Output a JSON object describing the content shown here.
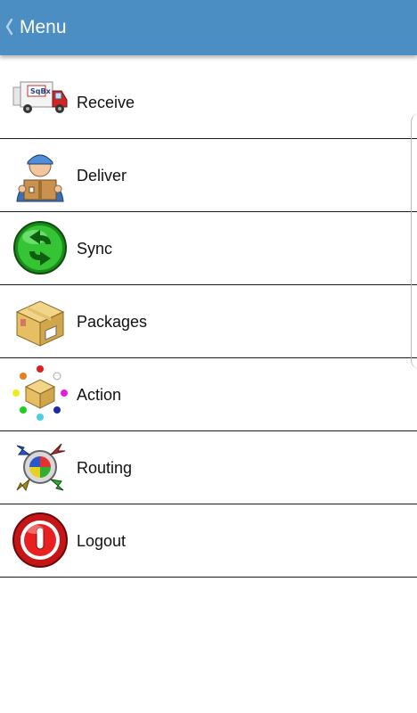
{
  "header": {
    "title": "Menu",
    "back_icon": "chevron-left-icon",
    "bg_color": "#4a8ec4"
  },
  "menu": {
    "items": [
      {
        "label": "Receive",
        "icon": "delivery-truck-icon"
      },
      {
        "label": "Deliver",
        "icon": "courier-with-box-icon"
      },
      {
        "label": "Sync",
        "icon": "sync-arrows-icon"
      },
      {
        "label": "Packages",
        "icon": "package-box-icon"
      },
      {
        "label": "Action",
        "icon": "box-with-dots-icon"
      },
      {
        "label": "Routing",
        "icon": "routing-arrows-icon"
      },
      {
        "label": "Logout",
        "icon": "power-icon"
      }
    ]
  }
}
